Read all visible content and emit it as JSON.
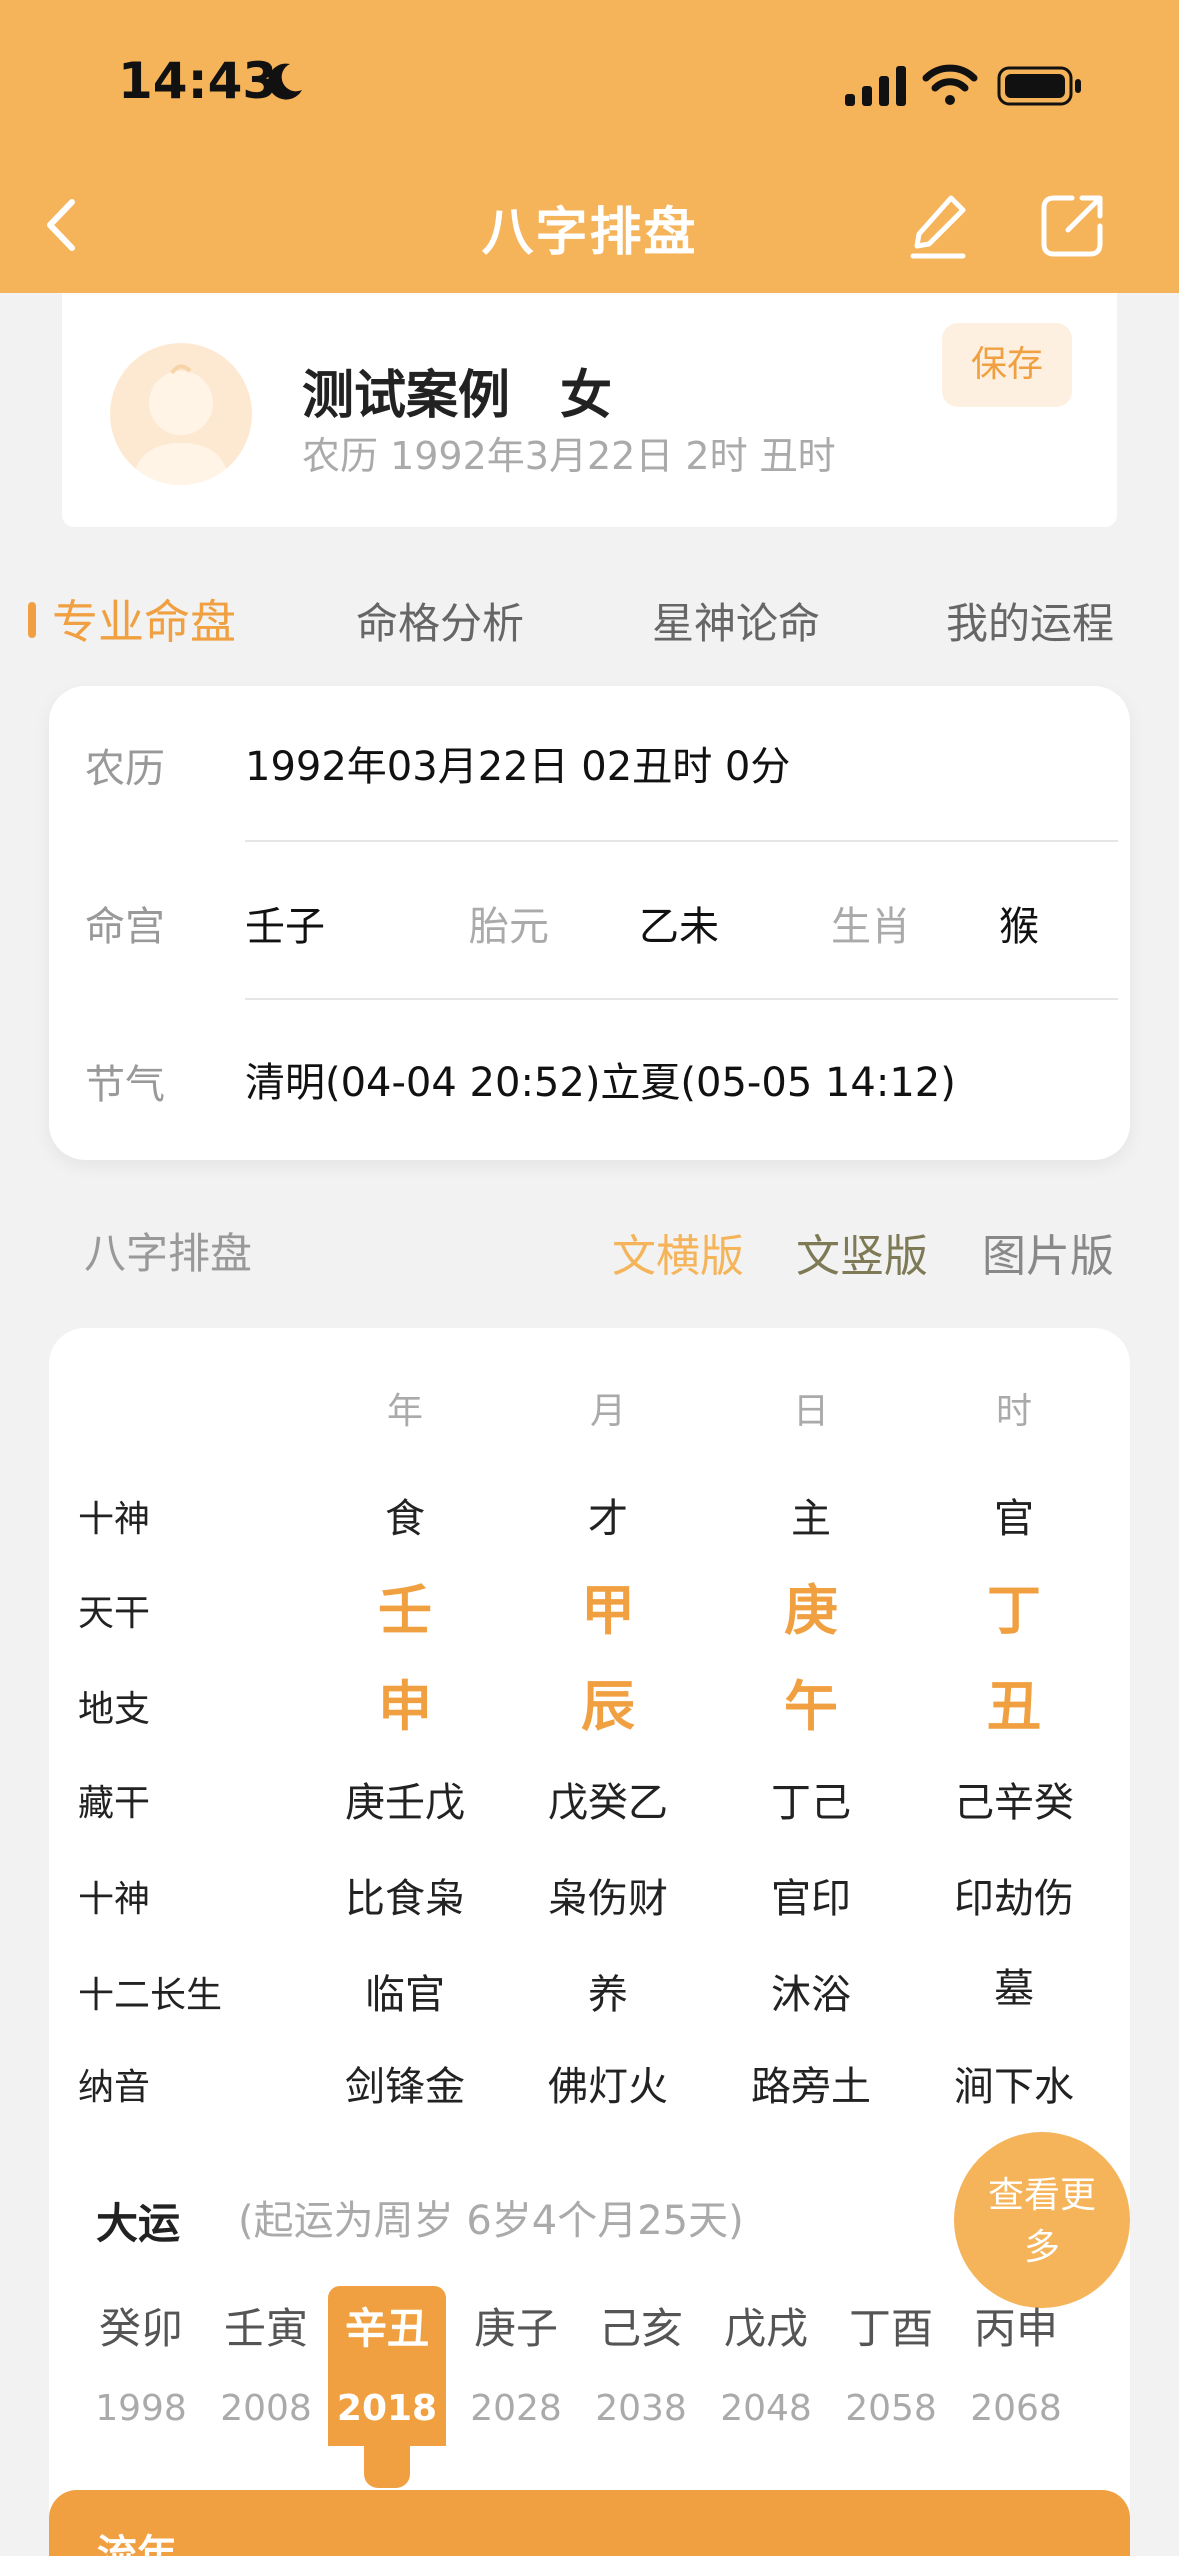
{
  "status": {
    "time": "14:43"
  },
  "nav": {
    "title": "八字排盘"
  },
  "profile": {
    "name": "测试案例",
    "gender": "女",
    "lunar": "农历 1992年3月22日 2时 丑时",
    "save_label": "保存"
  },
  "tabs": [
    "专业命盘",
    "命格分析",
    "星神论命",
    "我的运程"
  ],
  "info": {
    "lunar_label": "农历",
    "lunar_value": "1992年03月22日 02丑时 0分",
    "minggong_label": "命宫",
    "minggong_value": "壬子",
    "taiyuan_label": "胎元",
    "taiyuan_value": "乙未",
    "shengxiao_label": "生肖",
    "shengxiao_value": "猴",
    "jieqi_label": "节气",
    "jieqi_value": "清明(04-04 20:52)立夏(05-05 14:12)"
  },
  "section": {
    "title": "八字排盘",
    "versions": [
      "文横版",
      "文竖版",
      "图片版"
    ]
  },
  "bazi": {
    "columns": [
      "年",
      "月",
      "日",
      "时"
    ],
    "rows": [
      {
        "label": "十神",
        "cells": [
          "食",
          "才",
          "主",
          "官"
        ]
      },
      {
        "label": "天干",
        "cells": [
          "壬",
          "甲",
          "庚",
          "丁"
        ]
      },
      {
        "label": "地支",
        "cells": [
          "申",
          "辰",
          "午",
          "丑"
        ]
      },
      {
        "label": "藏干",
        "cells": [
          "庚壬戊",
          "戊癸乙",
          "丁己",
          "己辛癸"
        ]
      },
      {
        "label": "十神",
        "cells": [
          "比食枭",
          "枭伤财",
          "官印",
          "印劫伤"
        ]
      },
      {
        "label": "十二长生",
        "cells": [
          "临官",
          "养",
          "沐浴",
          "墓"
        ]
      },
      {
        "label": "纳音",
        "cells": [
          "剑锋金",
          "佛灯火",
          "路旁土",
          "涧下水"
        ]
      }
    ]
  },
  "dayun": {
    "title": "大运",
    "note": "(起运为周岁 6岁4个月25天)",
    "more_line1": "查看更",
    "more_line2": "多",
    "items": [
      {
        "gz": "癸卯",
        "year": "1998"
      },
      {
        "gz": "壬寅",
        "year": "2008"
      },
      {
        "gz": "辛丑",
        "year": "2018"
      },
      {
        "gz": "庚子",
        "year": "2028"
      },
      {
        "gz": "己亥",
        "year": "2038"
      },
      {
        "gz": "戊戌",
        "year": "2048"
      },
      {
        "gz": "丁酉",
        "year": "2058"
      },
      {
        "gz": "丙申",
        "year": "2068"
      }
    ]
  },
  "liunian": {
    "label": "流年"
  },
  "colors": {
    "accent": "#f0a040",
    "header": "#f5b35a"
  }
}
